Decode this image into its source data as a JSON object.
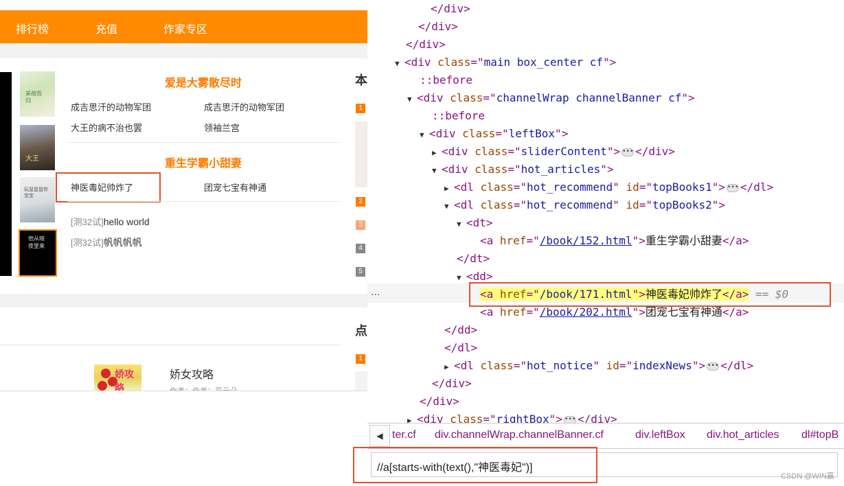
{
  "nav": {
    "items": [
      "排行榜",
      "充值",
      "作家专区"
    ]
  },
  "covers": [
    "采荷而归",
    "大王",
    "玩鼠鼠鼠你宝宝",
    "他从暗夜里来"
  ],
  "top_books1": {
    "title": "爱是大雾散尽时",
    "links": [
      "成吉思汗的动物军团",
      "成吉思汗的动物军团",
      "大王的病不治也罢",
      "领袖兰宫"
    ]
  },
  "top_books2": {
    "title": "重生学霸小甜妻",
    "links": [
      "神医毒妃帅炸了",
      "团宠七宝有神通"
    ]
  },
  "notices": [
    {
      "tag": "[测32试]",
      "text": "hello world"
    },
    {
      "tag": "[测32试]",
      "text": "帆帆帆帆"
    }
  ],
  "side": {
    "heading1": "本",
    "heading2": "点",
    "ranks": [
      "1",
      "2",
      "3",
      "4",
      "5"
    ],
    "rank2": [
      "1"
    ]
  },
  "book_card": {
    "cover_text": "娇攻略",
    "title": "娇女攻略",
    "author": "作者：作者：花云朵"
  },
  "dom_tree": {
    "lines": [
      {
        "t": "close",
        "tag": "div"
      },
      {
        "t": "close",
        "tag": "div"
      },
      {
        "t": "close",
        "tag": "div"
      },
      {
        "t": "open",
        "tag": "div",
        "attrs": [
          [
            "class",
            "main box_center cf"
          ]
        ]
      },
      {
        "t": "pseudo",
        "text": "::before"
      },
      {
        "t": "open",
        "tag": "div",
        "attrs": [
          [
            "class",
            "channelWrap channelBanner cf"
          ]
        ]
      },
      {
        "t": "pseudo",
        "text": "::before"
      },
      {
        "t": "open",
        "tag": "div",
        "attrs": [
          [
            "class",
            "leftBox"
          ]
        ]
      },
      {
        "t": "collapsed",
        "tag": "div",
        "attrs": [
          [
            "class",
            "sliderContent"
          ]
        ]
      },
      {
        "t": "open",
        "tag": "div",
        "attrs": [
          [
            "class",
            "hot_articles"
          ]
        ]
      },
      {
        "t": "collapsed",
        "tag": "dl",
        "attrs": [
          [
            "class",
            "hot_recommend"
          ],
          [
            "id",
            "topBooks1"
          ]
        ]
      },
      {
        "t": "open",
        "tag": "dl",
        "attrs": [
          [
            "class",
            "hot_recommend"
          ],
          [
            "id",
            "topBooks2"
          ]
        ]
      },
      {
        "t": "open",
        "tag": "dt",
        "attrs": []
      },
      {
        "t": "link",
        "tag": "a",
        "href": "/book/152.html",
        "text": "重生学霸小甜妻"
      },
      {
        "t": "close",
        "tag": "dt"
      },
      {
        "t": "open",
        "tag": "dd",
        "attrs": []
      },
      {
        "t": "link-selected",
        "tag": "a",
        "href": "/book/171.html",
        "text": "神医毒妃帅炸了",
        "ref": "== $0"
      },
      {
        "t": "link",
        "tag": "a",
        "href": "/book/202.html",
        "text": "团宠七宝有神通"
      },
      {
        "t": "close",
        "tag": "dd"
      },
      {
        "t": "close",
        "tag": "dl"
      },
      {
        "t": "collapsed",
        "tag": "dl",
        "attrs": [
          [
            "class",
            "hot_notice"
          ],
          [
            "id",
            "indexNews"
          ]
        ]
      },
      {
        "t": "close",
        "tag": "div"
      },
      {
        "t": "close",
        "tag": "div"
      },
      {
        "t": "collapsed",
        "tag": "div",
        "attrs": [
          [
            "class",
            "rightBox"
          ]
        ]
      }
    ],
    "dots": "..."
  },
  "breadcrumbs": [
    "ter.cf",
    "div.channelWrap.channelBanner.cf",
    "div.leftBox",
    "div.hot_articles",
    "dl#topB"
  ],
  "search": {
    "query": "//a[starts-with(text(),\"神医毒妃\")]"
  },
  "watermark": "CSDN @WIN赢"
}
